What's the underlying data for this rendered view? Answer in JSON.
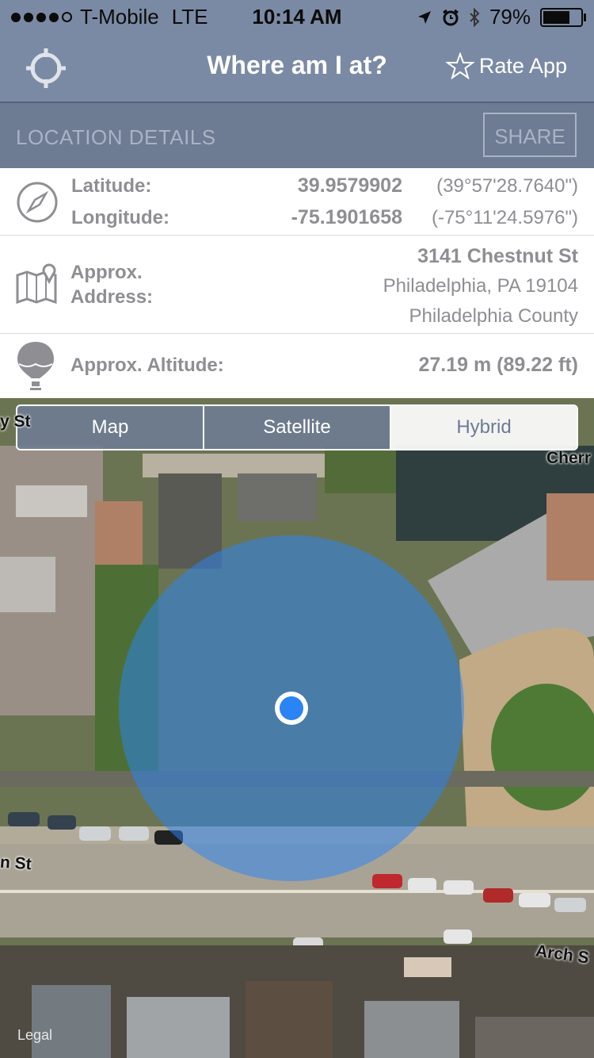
{
  "status_bar": {
    "carrier": "T-Mobile",
    "network": "LTE",
    "time": "10:14 AM",
    "battery": "79%",
    "battery_level": 0.79,
    "signal_bars_filled": 4,
    "signal_bars_total": 5
  },
  "nav": {
    "title": "Where am I at?",
    "rate_label": "Rate App"
  },
  "details": {
    "section_label": "LOCATION DETAILS",
    "share_label": "SHARE"
  },
  "coords": {
    "lat_label": "Latitude:",
    "lat_value": "39.9579902",
    "lat_dms": "(39°57'28.7640\")",
    "lon_label": "Longitude:",
    "lon_value": "-75.1901658",
    "lon_dms": "(-75°11'24.5976\")"
  },
  "address": {
    "label_line1": "Approx.",
    "label_line2": "Address:",
    "street": "3141 Chestnut St",
    "city": "Philadelphia, PA 19104",
    "county": "Philadelphia County"
  },
  "altitude": {
    "label": "Approx. Altitude:",
    "value": "27.19 m (89.22 ft)"
  },
  "map": {
    "tabs": [
      {
        "label": "Map",
        "selected": false
      },
      {
        "label": "Satellite",
        "selected": false
      },
      {
        "label": "Hybrid",
        "selected": true
      }
    ],
    "road_labels": [
      "y St",
      "Cherr",
      "n St",
      "Arch S"
    ],
    "legal": "Legal"
  },
  "colors": {
    "bar": "#7b8aa4",
    "accent": "#2a84f4",
    "text_gray": "#8e8e93"
  }
}
